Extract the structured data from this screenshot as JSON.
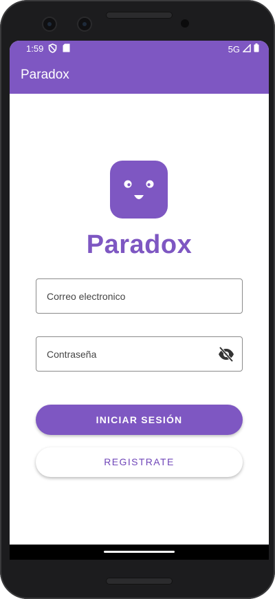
{
  "status_bar": {
    "time": "1:59",
    "network": "5G",
    "icons": [
      "vpn-shield-icon",
      "sd-card-icon",
      "signal-icon",
      "battery-icon"
    ]
  },
  "app_bar": {
    "title": "Paradox"
  },
  "logo": {
    "brand_name": "Paradox",
    "icon": "smiley-face-icon"
  },
  "form": {
    "email": {
      "placeholder": "Correo electronico",
      "value": ""
    },
    "password": {
      "placeholder": "Contraseña",
      "value": "",
      "toggle_icon": "eye-off-icon"
    }
  },
  "actions": {
    "login_label": "INICIAR SESIÓN",
    "register_label": "REGISTRATE"
  },
  "colors": {
    "primary": "#7e57c2",
    "primary_text": "#6f45b8",
    "background": "#ffffff"
  }
}
